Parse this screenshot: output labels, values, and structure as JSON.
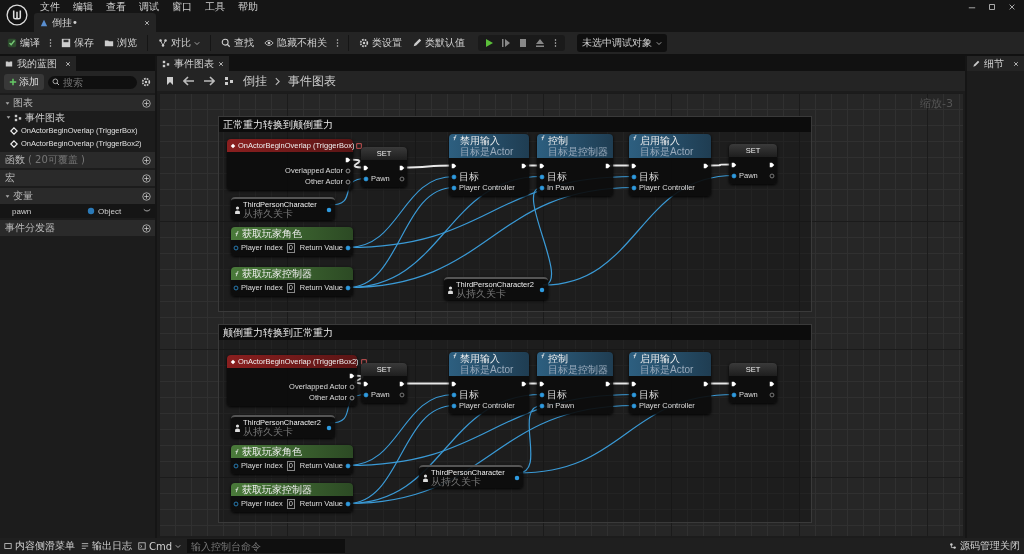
{
  "menu": [
    "文件",
    "编辑",
    "查看",
    "调试",
    "窗口",
    "工具",
    "帮助"
  ],
  "document_tab": {
    "label": "倒挂•"
  },
  "toolbar": [
    {
      "label": "编译",
      "kind": "more"
    },
    {
      "label": "保存",
      "kind": "plain"
    },
    {
      "label": "浏览",
      "kind": "plain"
    },
    {
      "label": "对比",
      "kind": "dropdown"
    },
    {
      "label": "查找",
      "kind": "plain"
    },
    {
      "label": "隐藏不相关",
      "kind": "more"
    },
    {
      "label": "类设置",
      "kind": "plain"
    },
    {
      "label": "类默认值",
      "kind": "plain"
    }
  ],
  "debug_selector": "未选中调试对象",
  "my_blueprint": {
    "title": "我的蓝图",
    "add_button": "添加",
    "search": {
      "placeholder": "搜索"
    },
    "sections": [
      {
        "label": "图表",
        "expanded": true,
        "children": [
          {
            "label": "事件图表",
            "expanded": true,
            "children": [
              {
                "label": "OnActorBeginOverlap (TriggerBox)"
              },
              {
                "label": "OnActorBeginOverlap (TriggerBox2)"
              }
            ]
          }
        ]
      },
      {
        "label": "函数",
        "note": "( 20可覆盖 )"
      },
      {
        "label": "宏"
      },
      {
        "label": "变量",
        "expanded": true,
        "variables": [
          {
            "name": "pawn",
            "type": "Object"
          }
        ]
      },
      {
        "label": "事件分发器"
      }
    ]
  },
  "graph_tab": {
    "label": "事件图表"
  },
  "breadcrumb": [
    "倒挂",
    "事件图表"
  ],
  "zoom": "缩放-3",
  "graphs": [
    {
      "comment": "正常重力转换到颠倒重力",
      "nodes": [
        {
          "kind": "event",
          "title": "OnActorBeginOverlap (TriggerBox)",
          "outputs": [
            {
              "label": "Overlapped Actor",
              "connected": false
            },
            {
              "label": "Other Actor",
              "connected": false
            }
          ]
        },
        {
          "kind": "set",
          "title": "SET",
          "inputs": [
            {
              "label": "Pawn",
              "connected": true
            }
          ]
        },
        {
          "kind": "function",
          "title": "禁用输入",
          "subtitle": "目标是Actor",
          "inputs": [
            {
              "label": "目标",
              "connected": true
            },
            {
              "label": "Player Controller",
              "connected": true
            }
          ]
        },
        {
          "kind": "function",
          "title": "控制",
          "subtitle": "目标是控制器",
          "inputs": [
            {
              "label": "目标",
              "connected": true
            },
            {
              "label": "In Pawn",
              "connected": true
            }
          ]
        },
        {
          "kind": "function",
          "title": "启用输入",
          "subtitle": "目标是Actor",
          "inputs": [
            {
              "label": "目标",
              "connected": true
            },
            {
              "label": "Player Controller",
              "connected": true
            }
          ]
        },
        {
          "kind": "set",
          "title": "SET",
          "inputs": [
            {
              "label": "Pawn",
              "connected": true
            }
          ]
        },
        {
          "kind": "variable",
          "title": "ThirdPersonCharacter",
          "subtitle": "从持久关卡"
        },
        {
          "kind": "pure",
          "title": "获取玩家角色",
          "inputs": [
            {
              "label": "Player Index",
              "connected": false,
              "value": "0"
            }
          ],
          "outputs": [
            {
              "label": "Return Value",
              "connected": true
            }
          ]
        },
        {
          "kind": "pure",
          "title": "获取玩家控制器",
          "inputs": [
            {
              "label": "Player Index",
              "connected": false,
              "value": "0"
            }
          ],
          "outputs": [
            {
              "label": "Return Value",
              "connected": true
            }
          ]
        },
        {
          "kind": "variable",
          "title": "ThirdPersonCharacter2",
          "subtitle": "从持久关卡"
        }
      ]
    },
    {
      "comment": "颠倒重力转换到正常重力",
      "nodes": [
        {
          "kind": "event",
          "title": "OnActorBeginOverlap (TriggerBox2)",
          "outputs": [
            {
              "label": "Overlapped Actor",
              "connected": false
            },
            {
              "label": "Other Actor",
              "connected": false
            }
          ]
        },
        {
          "kind": "set",
          "title": "SET",
          "inputs": [
            {
              "label": "Pawn",
              "connected": true
            }
          ]
        },
        {
          "kind": "function",
          "title": "禁用输入",
          "subtitle": "目标是Actor",
          "inputs": [
            {
              "label": "目标",
              "connected": true
            },
            {
              "label": "Player Controller",
              "connected": true
            }
          ]
        },
        {
          "kind": "function",
          "title": "控制",
          "subtitle": "目标是控制器",
          "inputs": [
            {
              "label": "目标",
              "connected": true
            },
            {
              "label": "In Pawn",
              "connected": true
            }
          ]
        },
        {
          "kind": "function",
          "title": "启用输入",
          "subtitle": "目标是Actor",
          "inputs": [
            {
              "label": "目标",
              "connected": true
            },
            {
              "label": "Player Controller",
              "connected": true
            }
          ]
        },
        {
          "kind": "set",
          "title": "SET",
          "inputs": [
            {
              "label": "Pawn",
              "connected": true
            }
          ]
        },
        {
          "kind": "variable",
          "title": "ThirdPersonCharacter2",
          "subtitle": "从持久关卡"
        },
        {
          "kind": "pure",
          "title": "获取玩家角色",
          "inputs": [
            {
              "label": "Player Index",
              "connected": false,
              "value": "0"
            }
          ],
          "outputs": [
            {
              "label": "Return Value",
              "connected": true
            }
          ]
        },
        {
          "kind": "pure",
          "title": "获取玩家控制器",
          "inputs": [
            {
              "label": "Player Index",
              "connected": false,
              "value": "0"
            }
          ],
          "outputs": [
            {
              "label": "Return Value",
              "connected": true
            }
          ]
        },
        {
          "kind": "variable",
          "title": "ThirdPersonCharacter",
          "subtitle": "从持久关卡"
        }
      ]
    }
  ],
  "details_tab": {
    "label": "细节"
  },
  "status_bar": {
    "content_drawer": "内容侧滑菜单",
    "output_log": "输出日志",
    "cmd": "Cmd",
    "console": {
      "placeholder": "输入控制台命令"
    },
    "source_control": "源码管理关闭"
  }
}
